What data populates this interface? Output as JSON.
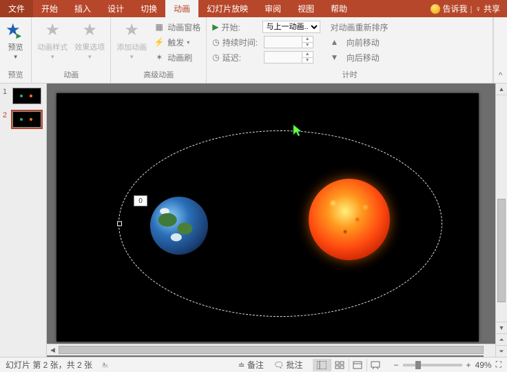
{
  "tabs": {
    "file": "文件",
    "home": "开始",
    "insert": "插入",
    "design": "设计",
    "transition": "切换",
    "animation": "动画",
    "slideshow": "幻灯片放映",
    "review": "审阅",
    "view": "视图",
    "help": "帮助",
    "tellme": "告诉我",
    "share": "共享"
  },
  "ribbon": {
    "preview": {
      "btn": "预览",
      "group": "预览"
    },
    "anim": {
      "styles": "动画样式",
      "options": "效果选项",
      "group": "动画"
    },
    "advanced": {
      "add": "添加动画",
      "pane": "动画窗格",
      "trigger": "触发",
      "painter": "动画刷",
      "group": "高级动画"
    },
    "timing": {
      "start": "开始:",
      "start_val": "与上一动画...",
      "duration": "持续时间:",
      "delay": "延迟:",
      "reorder": "对动画重新排序",
      "fwd": "向前移动",
      "back": "向后移动",
      "group": "计时"
    }
  },
  "slide": {
    "tag": "0"
  },
  "thumbs": [
    "1",
    "2"
  ],
  "status": {
    "pos": "幻灯片 第 2 张，共 2 张",
    "notes": "备注",
    "comments": "批注",
    "zoom": "49%",
    "minus": "−",
    "plus": "+"
  }
}
